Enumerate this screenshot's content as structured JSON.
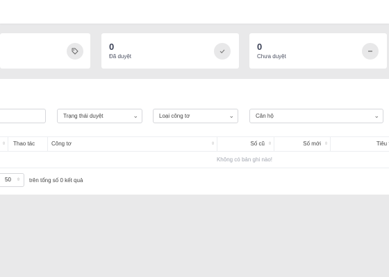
{
  "stats": [
    {
      "value": "",
      "label": "",
      "icon": "tag-icon"
    },
    {
      "value": "0",
      "label": "Đã duyệt",
      "icon": "check-icon"
    },
    {
      "value": "0",
      "label": "Chưa duyệt",
      "icon": "minus-icon"
    }
  ],
  "filters": {
    "search_value": "",
    "status_placeholder": "Trạng thái duyệt",
    "type_placeholder": "Loại công tơ",
    "apartment_placeholder": "Căn hộ"
  },
  "table": {
    "columns": [
      "",
      "Thao tác",
      "Công tơ",
      "Số cũ",
      "Số mới",
      "Tiêu th"
    ],
    "empty_message": "Không có bản ghi nào!"
  },
  "pagination": {
    "page_size": "50",
    "total_text": "trên tổng số 0 kết quả"
  }
}
